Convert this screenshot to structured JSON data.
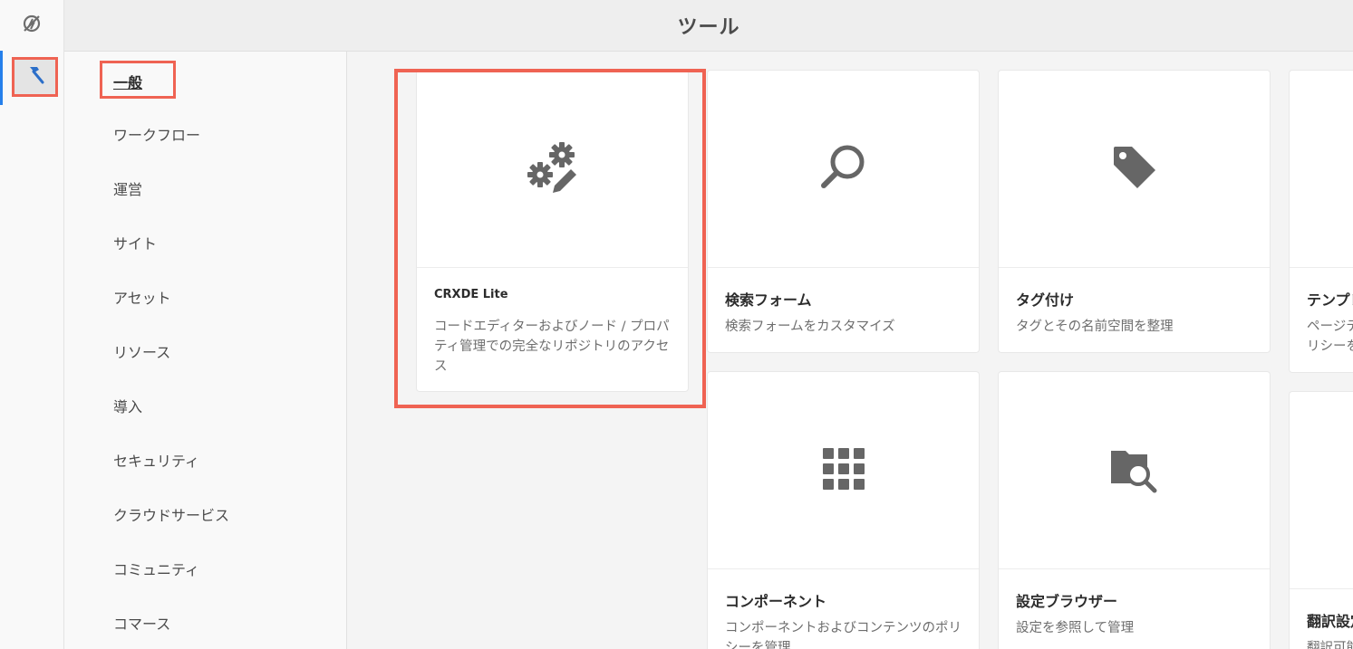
{
  "header": {
    "title": "ツール"
  },
  "rail": {
    "top_icon": "no-sync-icon",
    "tools_icon": "hammer-icon",
    "accent_color": "#2680eb"
  },
  "categories": {
    "active": "一般",
    "items": [
      "ワークフロー",
      "運営",
      "サイト",
      "アセット",
      "リソース",
      "導入",
      "セキュリティ",
      "クラウドサービス",
      "コミュニティ",
      "コマース"
    ]
  },
  "cards": [
    {
      "icon": "gears-edit-icon",
      "title": "CRXDE Lite",
      "desc": "コードエディターおよびノード / プロパティ管理での完全なリポジトリのアクセス"
    },
    {
      "icon": "search-icon",
      "title": "検索フォーム",
      "desc": "検索フォームをカスタマイズ"
    },
    {
      "icon": "tag-icon",
      "title": "タグ付け",
      "desc": "タグとその名前空間を整理"
    },
    {
      "icon": "template-icon",
      "title": "テンプレ",
      "desc": "ページテ リシーを"
    },
    {
      "icon": "apps-grid-icon",
      "title": "コンポーネント",
      "desc": "コンポーネントおよびコンテンツのポリシーを管理"
    },
    {
      "icon": "folder-search-icon",
      "title": "設定ブラウザー",
      "desc": "設定を参照して管理"
    },
    {
      "icon": "translation-icon",
      "title": "翻訳設定",
      "desc": "翻訳可能"
    }
  ],
  "highlight_color": "#ef6353"
}
